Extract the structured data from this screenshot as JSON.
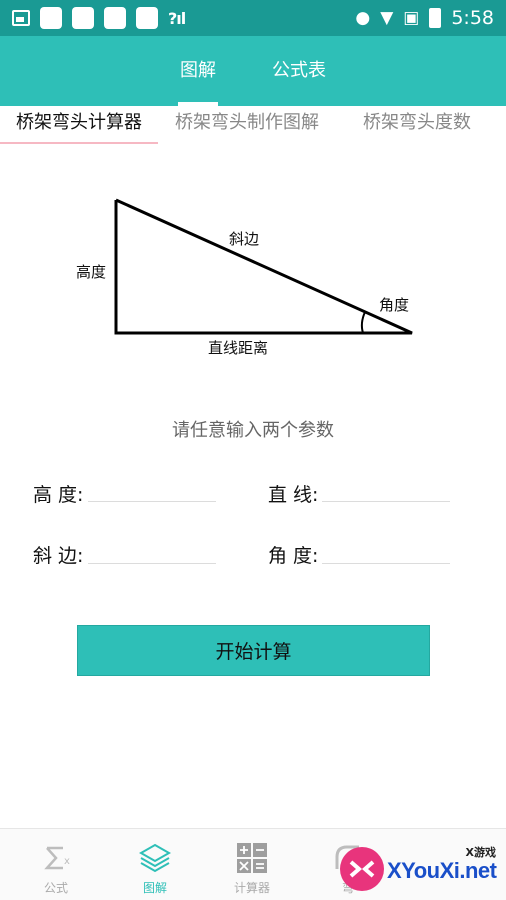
{
  "status_bar": {
    "time": "5:58",
    "signal": "?ıl"
  },
  "header": {
    "tabs": [
      {
        "label": "图解",
        "active": true
      },
      {
        "label": "公式表",
        "active": false
      }
    ]
  },
  "sub_tabs": [
    {
      "label": "桥架弯头计算器",
      "active": true
    },
    {
      "label": "桥架弯头制作图解",
      "active": false
    },
    {
      "label": "桥架弯头度数",
      "active": false
    }
  ],
  "diagram": {
    "height_label": "高度",
    "hypotenuse_label": "斜边",
    "angle_label": "角度",
    "base_label": "直线距离"
  },
  "prompt": "请任意输入两个参数",
  "form": {
    "height_label": "高 度:",
    "straight_label": "直 线:",
    "hypotenuse_label": "斜 边:",
    "angle_label": "角 度:",
    "height_value": "",
    "straight_value": "",
    "hypotenuse_value": "",
    "angle_value": ""
  },
  "calc_button": "开始计算",
  "bottom_nav": [
    {
      "label": "公式",
      "icon": "sigma-icon",
      "active": false
    },
    {
      "label": "图解",
      "icon": "layers-icon",
      "active": true
    },
    {
      "label": "计算器",
      "icon": "calculator-icon",
      "active": false
    },
    {
      "label": "弯",
      "icon": "elbow-icon",
      "active": false
    }
  ],
  "watermark": {
    "top": "X游戏",
    "main": "XYouXi.net"
  },
  "colors": {
    "primary": "#2ebfb7",
    "status_bar": "#1a9a94",
    "tab_indicator": "#f6b8c3"
  }
}
